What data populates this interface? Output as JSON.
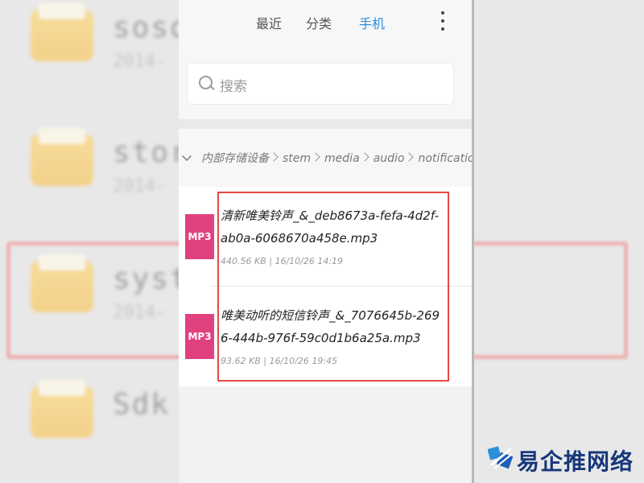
{
  "background": {
    "rows": [
      {
        "name": "soso",
        "date": "2014-"
      },
      {
        "name": "stor",
        "date": "2014-"
      },
      {
        "name": "syst",
        "date": "2014-"
      },
      {
        "name": "Sdk",
        "date": ""
      }
    ]
  },
  "tabs": [
    {
      "label": "最近",
      "active": false
    },
    {
      "label": "分类",
      "active": false
    },
    {
      "label": "手机",
      "active": true
    }
  ],
  "search": {
    "placeholder": "搜索"
  },
  "breadcrumbs": [
    "内部存储设备",
    "stem",
    "media",
    "audio",
    "notifications"
  ],
  "files": [
    {
      "badge": "MP3",
      "name": "清新唯美铃声_&_deb8673a-fefa-4d2f-ab0a-6068670a458e.mp3",
      "meta": "440.56 KB | 16/10/26 14:19"
    },
    {
      "badge": "MP3",
      "name": "唯美动听的短信铃声_&_7076645b-2696-444b-976f-59c0d1b6a25a.mp3",
      "meta": "93.62 KB | 16/10/26 19:45"
    }
  ],
  "watermark": {
    "text": "易企推网络"
  },
  "colors": {
    "accent": "#2f8de0",
    "mp3": "#e2417f",
    "highlight": "#e54848"
  }
}
